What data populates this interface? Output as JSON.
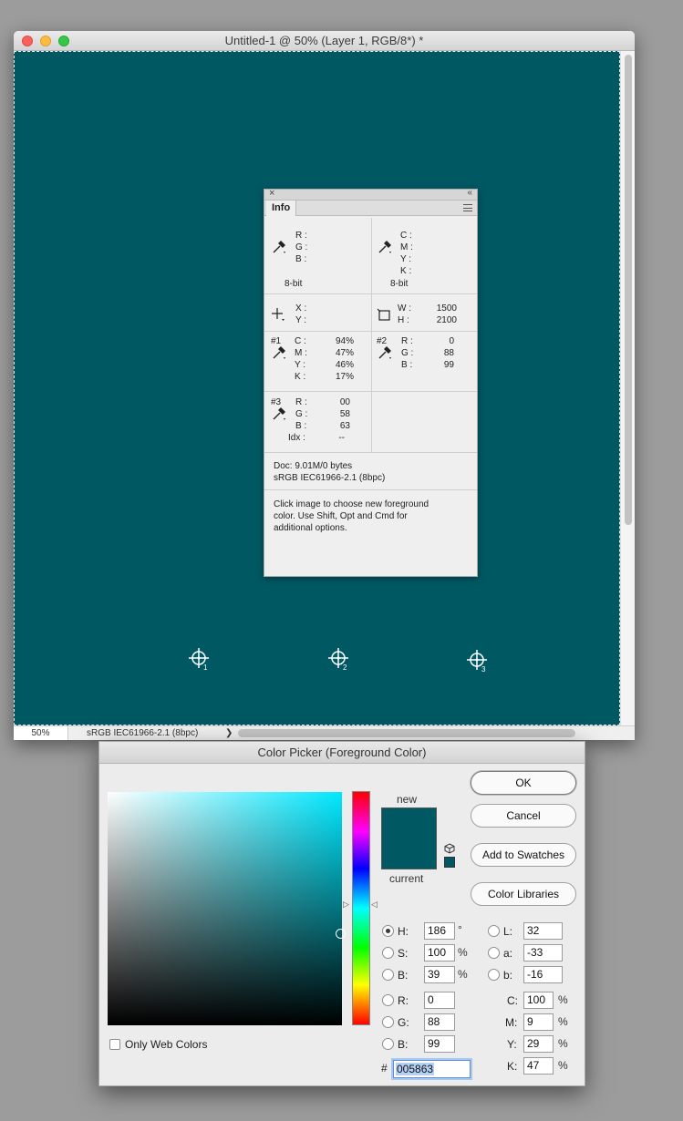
{
  "doc": {
    "title": "Untitled-1 @ 50% (Layer 1, RGB/8*) *",
    "canvas_color": "#005863",
    "zoom": "50%",
    "profile": "sRGB IEC61966-2.1 (8bpc)",
    "status_arrow": "❯",
    "samplers": [
      "1",
      "2",
      "3"
    ]
  },
  "info": {
    "tab": "Info",
    "close": "×",
    "collapse": "«",
    "rgb_labels": [
      "R :",
      "G :",
      "B :"
    ],
    "rgb_bits": "8-bit",
    "cmyk_labels": [
      "C :",
      "M :",
      "Y :",
      "K :"
    ],
    "cmyk_bits": "8-bit",
    "xy_labels": [
      "X :",
      "Y :"
    ],
    "wh_labels": [
      "W :",
      "H :"
    ],
    "wh_values": [
      "1500",
      "2100"
    ],
    "s1": {
      "id": "#1",
      "labels": [
        "C :",
        "M :",
        "Y :",
        "K :"
      ],
      "values": [
        "94%",
        "47%",
        "46%",
        "17%"
      ]
    },
    "s2": {
      "id": "#2",
      "labels": [
        "R :",
        "G :",
        "B :"
      ],
      "values": [
        "0",
        "88",
        "99"
      ]
    },
    "s3": {
      "id": "#3",
      "labels": [
        "R :",
        "G :",
        "B :",
        "Idx :"
      ],
      "values": [
        "00",
        "58",
        "63",
        "--"
      ]
    },
    "doc_size": "Doc: 9.01M/0 bytes",
    "doc_profile": "sRGB IEC61966-2.1 (8bpc)",
    "hint": [
      "Click image to choose new foreground",
      "color.  Use Shift, Opt and Cmd for",
      "additional options."
    ]
  },
  "picker": {
    "title": "Color Picker (Foreground Color)",
    "new_label": "new",
    "current_label": "current",
    "new_color": "#005863",
    "current_color": "#005863",
    "buttons": {
      "ok": "OK",
      "cancel": "Cancel",
      "add": "Add to Swatches",
      "libraries": "Color Libraries"
    },
    "hsb": [
      {
        "label": "H:",
        "value": "186",
        "unit": "°",
        "selected": true
      },
      {
        "label": "S:",
        "value": "100",
        "unit": "%",
        "selected": false
      },
      {
        "label": "B:",
        "value": "39",
        "unit": "%",
        "selected": false
      }
    ],
    "rgb": [
      {
        "label": "R:",
        "value": "0"
      },
      {
        "label": "G:",
        "value": "88"
      },
      {
        "label": "B:",
        "value": "99"
      }
    ],
    "lab": [
      {
        "label": "L:",
        "value": "32"
      },
      {
        "label": "a:",
        "value": "-33"
      },
      {
        "label": "b:",
        "value": "-16"
      }
    ],
    "cmyk": [
      {
        "label": "C:",
        "value": "100",
        "unit": "%"
      },
      {
        "label": "M:",
        "value": "9",
        "unit": "%"
      },
      {
        "label": "Y:",
        "value": "29",
        "unit": "%"
      },
      {
        "label": "K:",
        "value": "47",
        "unit": "%"
      }
    ],
    "hex_label": "#",
    "hex": "005863",
    "web_only": "Only Web Colors",
    "web_only_checked": false
  }
}
